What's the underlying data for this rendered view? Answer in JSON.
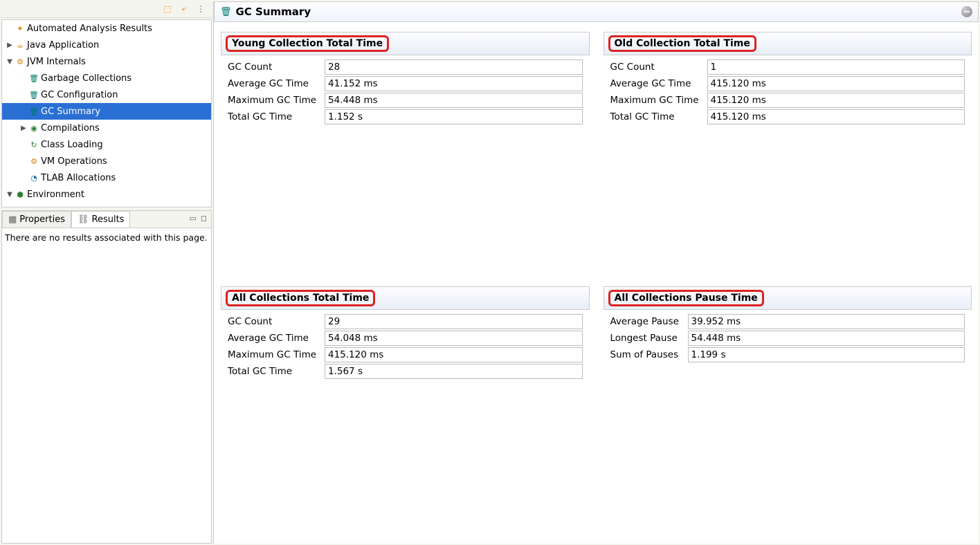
{
  "page_title": "GC Summary",
  "tree": {
    "items": [
      {
        "label": "Automated Analysis Results",
        "indent": 0,
        "expander": "",
        "icon": "analysis"
      },
      {
        "label": "Java Application",
        "indent": 0,
        "expander": "▶",
        "icon": "java"
      },
      {
        "label": "JVM Internals",
        "indent": 0,
        "expander": "▼",
        "icon": "jvm"
      },
      {
        "label": "Garbage Collections",
        "indent": 1,
        "expander": "",
        "icon": "trash"
      },
      {
        "label": "GC Configuration",
        "indent": 1,
        "expander": "",
        "icon": "trash-cfg"
      },
      {
        "label": "GC Summary",
        "indent": 1,
        "expander": "",
        "icon": "trash",
        "selected": true
      },
      {
        "label": "Compilations",
        "indent": 1,
        "expander": "▶",
        "icon": "comp"
      },
      {
        "label": "Class Loading",
        "indent": 1,
        "expander": "",
        "icon": "load"
      },
      {
        "label": "VM Operations",
        "indent": 1,
        "expander": "",
        "icon": "vmop"
      },
      {
        "label": "TLAB Allocations",
        "indent": 1,
        "expander": "",
        "icon": "tlab"
      },
      {
        "label": "Environment",
        "indent": 0,
        "expander": "▼",
        "icon": "env"
      }
    ]
  },
  "prop_tabs": {
    "properties": "Properties",
    "results": "Results"
  },
  "prop_body": "There are no results associated with this page.",
  "sections": {
    "young": {
      "title": "Young Collection Total Time",
      "rows": [
        {
          "label": "GC Count",
          "value": "28"
        },
        {
          "label": "Average GC Time",
          "value": "41.152 ms"
        },
        {
          "label": "Maximum GC Time",
          "value": "54.448 ms"
        },
        {
          "label": "Total GC Time",
          "value": "1.152 s"
        }
      ]
    },
    "old": {
      "title": "Old Collection Total Time",
      "rows": [
        {
          "label": "GC Count",
          "value": "1"
        },
        {
          "label": "Average GC Time",
          "value": "415.120 ms"
        },
        {
          "label": "Maximum GC Time",
          "value": "415.120 ms"
        },
        {
          "label": "Total GC Time",
          "value": "415.120 ms"
        }
      ]
    },
    "all_total": {
      "title": "All Collections Total Time",
      "rows": [
        {
          "label": "GC Count",
          "value": "29"
        },
        {
          "label": "Average GC Time",
          "value": "54.048 ms"
        },
        {
          "label": "Maximum GC Time",
          "value": "415.120 ms"
        },
        {
          "label": "Total GC Time",
          "value": "1.567 s"
        }
      ]
    },
    "all_pause": {
      "title": "All Collections Pause Time",
      "rows": [
        {
          "label": "Average Pause",
          "value": "39.952 ms"
        },
        {
          "label": "Longest Pause",
          "value": "54.448 ms"
        },
        {
          "label": "Sum of Pauses",
          "value": "1.199 s"
        }
      ]
    }
  }
}
